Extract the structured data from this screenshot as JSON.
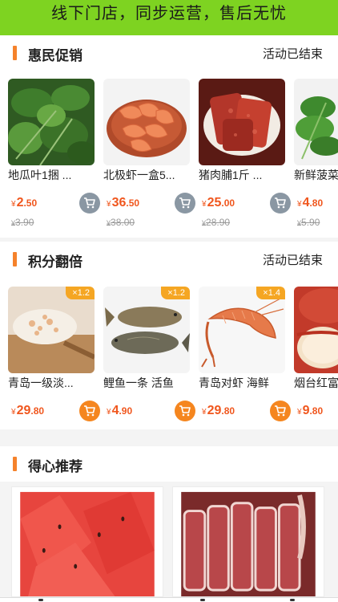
{
  "banner": {
    "text": "线下门店，同步运营，售后无忧"
  },
  "sections": {
    "promo": {
      "title": "惠民促销",
      "status": "活动已结束"
    },
    "points": {
      "title": "积分翻倍",
      "status": "活动已结束"
    },
    "recommend": {
      "title": "得心推荐"
    }
  },
  "promo_items": [
    {
      "name": "地瓜叶1捆 ...",
      "currency": "¥",
      "price_int": "2",
      "price_dec": ".50",
      "old_price": "3.90",
      "image": "sweet-potato-leaves"
    },
    {
      "name": "北极虾一盒5...",
      "currency": "¥",
      "price_int": "36",
      "price_dec": ".50",
      "old_price": "38.00",
      "image": "arctic-shrimp"
    },
    {
      "name": "猪肉脯1斤 ...",
      "currency": "¥",
      "price_int": "25",
      "price_dec": ".00",
      "old_price": "28.90",
      "image": "pork-jerky"
    },
    {
      "name": "新鲜菠菜",
      "currency": "¥",
      "price_int": "4",
      "price_dec": ".80",
      "old_price": "5.90",
      "image": "spinach"
    }
  ],
  "points_items": [
    {
      "name": "青岛一级淡...",
      "currency": "¥",
      "price_int": "29",
      "price_dec": ".80",
      "badge": "×1.2",
      "image": "dried-shrimp"
    },
    {
      "name": "鲤鱼一条  活鱼",
      "currency": "¥",
      "price_int": "4",
      "price_dec": ".90",
      "badge": "×1.2",
      "image": "carp"
    },
    {
      "name": "青岛对虾  海鲜",
      "currency": "¥",
      "price_int": "29",
      "price_dec": ".80",
      "badge": "×1.4",
      "image": "prawn"
    },
    {
      "name": "烟台红富",
      "currency": "¥",
      "price_int": "9",
      "price_dec": ".80",
      "badge": "",
      "image": "apple"
    }
  ],
  "colors": {
    "accent": "#f5822b",
    "banner": "#7ed321",
    "price": "#f0561d",
    "cart_grey": "#8a97a3",
    "cart_orange": "#f5861f",
    "badge": "#f5a623"
  },
  "icons": {
    "cart": "shopping-cart-icon"
  }
}
